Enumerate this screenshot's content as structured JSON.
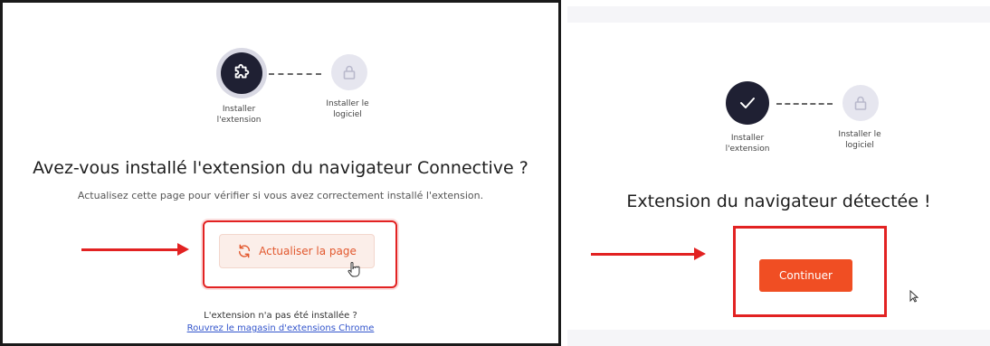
{
  "left": {
    "step1_label": "Installer l'extension",
    "step2_label": "Installer le logiciel",
    "heading": "Avez-vous installé l'extension du navigateur Connective ?",
    "subtext": "Actualisez cette page pour vérifier si vous avez correctement installé l'extension.",
    "refresh_button_label": "Actualiser la page",
    "not_installed_text": "L'extension n'a pas été installée ?",
    "store_link": "Rouvrez le magasin d'extensions Chrome",
    "step1_icon": "puzzle-icon",
    "step2_icon": "lock-icon"
  },
  "right": {
    "step1_label": "Installer l'extension",
    "step2_label": "Installer le logiciel",
    "heading": "Extension du navigateur détectée !",
    "continue_button_label": "Continuer",
    "step1_icon": "check-icon",
    "step2_icon": "lock-icon"
  },
  "colors": {
    "accent": "#f04e23",
    "annotation_red": "#e22222",
    "step_active": "#1f2033",
    "step_inactive": "#e6e6ef",
    "link": "#3355cc"
  }
}
